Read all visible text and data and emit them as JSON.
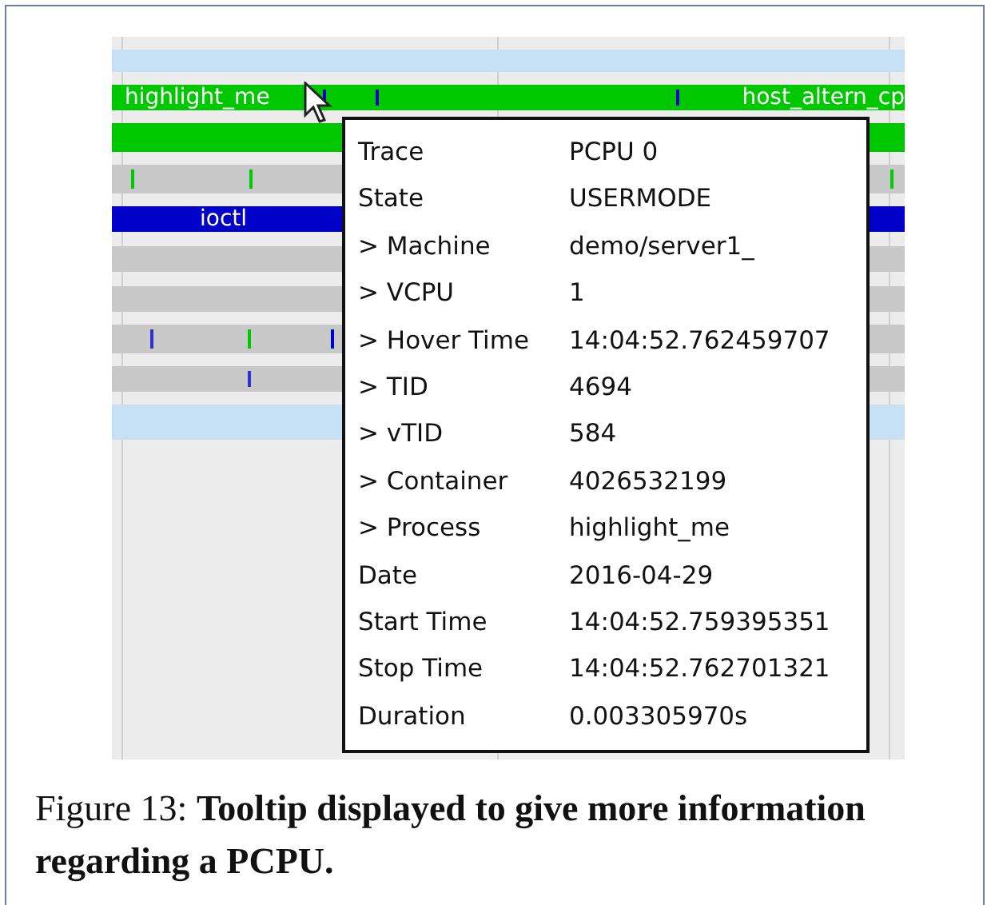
{
  "timeline": {
    "rows": [
      {
        "color": "#c8e0f4",
        "labels": []
      },
      {
        "color": "#00c800",
        "labels": [
          "highlight_me",
          "host_altern_cp"
        ]
      },
      {
        "color": "#00c800",
        "labels": []
      },
      {
        "color": "#c8c8c8",
        "labels": []
      },
      {
        "color": "#0000c8",
        "labels": [
          "ioctl"
        ]
      },
      {
        "color": "#c8c8c8",
        "labels": []
      },
      {
        "color": "#c8c8c8",
        "labels": []
      },
      {
        "color": "#c8c8c8",
        "labels": []
      },
      {
        "color": "#c8c8c8",
        "labels": []
      },
      {
        "color": "#c8e0f4",
        "labels": []
      }
    ]
  },
  "tooltip": {
    "rows": [
      {
        "key": "Trace",
        "value": "PCPU 0"
      },
      {
        "key": "State",
        "value": "USERMODE"
      },
      {
        "key": "> Machine",
        "value": "demo/server1_"
      },
      {
        "key": "> VCPU",
        "value": "1"
      },
      {
        "key": "> Hover Time",
        "value": "14:04:52.762459707"
      },
      {
        "key": "> TID",
        "value": "4694"
      },
      {
        "key": "> vTID",
        "value": "584"
      },
      {
        "key": "> Container",
        "value": "4026532199"
      },
      {
        "key": "> Process",
        "value": "highlight_me"
      },
      {
        "key": "Date",
        "value": "2016-04-29"
      },
      {
        "key": "Start Time",
        "value": "14:04:52.759395351"
      },
      {
        "key": "Stop Time",
        "value": "14:04:52.762701321"
      },
      {
        "key": "Duration",
        "value": "0.003305970s"
      }
    ]
  },
  "caption": "Figure 13: **Tooltip displayed to give more information regarding a PCPU.**"
}
